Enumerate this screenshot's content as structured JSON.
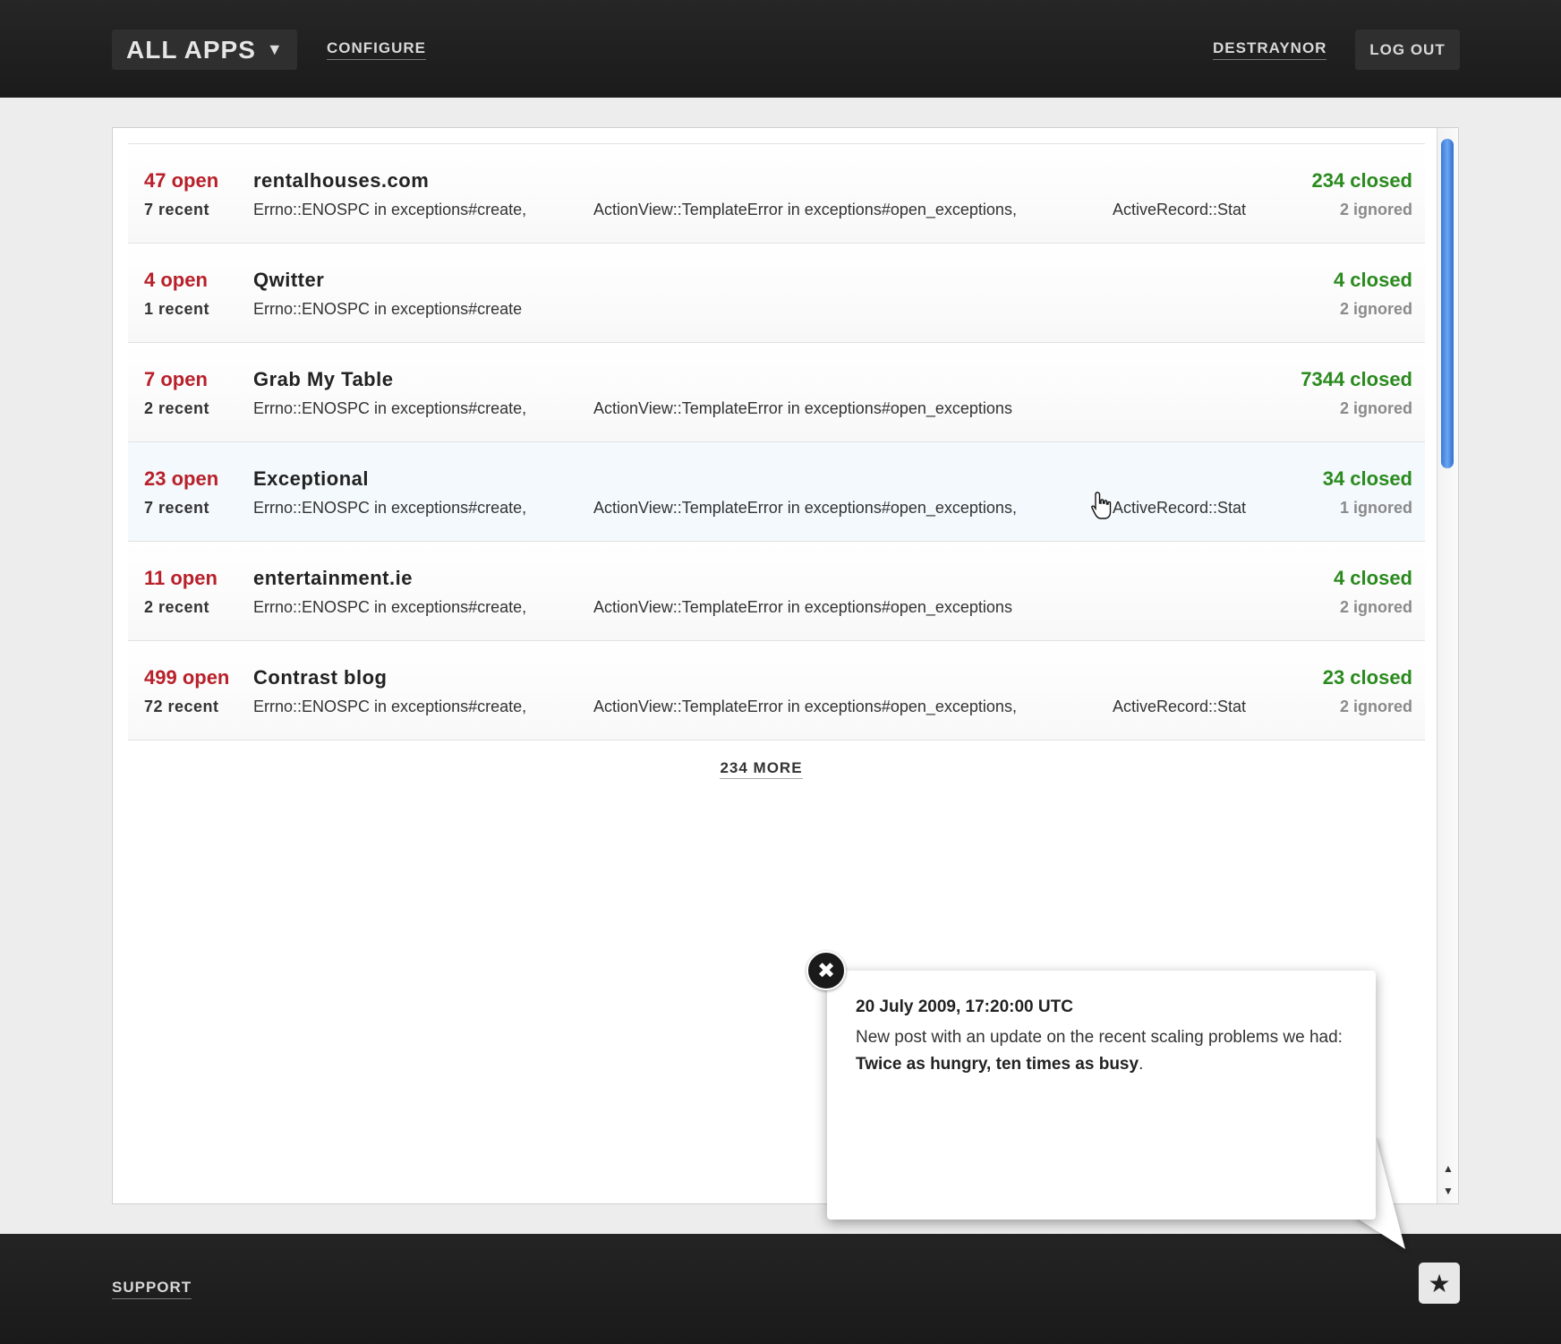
{
  "header": {
    "apps_label": "ALL APPS",
    "configure_label": "CONFIGURE",
    "user_label": "DESTRAYNOR",
    "logout_label": "LOG OUT"
  },
  "apps": [
    {
      "open": "47 open",
      "recent": "7 recent",
      "name": "rentalhouses.com",
      "errors": [
        "Errno::ENOSPC in exceptions#create,",
        "ActionView::TemplateError in exceptions#open_exceptions,",
        "ActiveRecord::Stat"
      ],
      "closed": "234 closed",
      "ignored": "2 ignored"
    },
    {
      "open": "4 open",
      "recent": "1 recent",
      "name": "Qwitter",
      "errors": [
        "Errno::ENOSPC in exceptions#create",
        "",
        ""
      ],
      "closed": "4 closed",
      "ignored": "2 ignored"
    },
    {
      "open": "7 open",
      "recent": "2 recent",
      "name": "Grab My Table",
      "errors": [
        "Errno::ENOSPC in exceptions#create,",
        "ActionView::TemplateError in exceptions#open_exceptions",
        ""
      ],
      "closed": "7344 closed",
      "ignored": "2 ignored"
    },
    {
      "open": "23 open",
      "recent": "7 recent",
      "name": "Exceptional",
      "errors": [
        "Errno::ENOSPC in exceptions#create,",
        "ActionView::TemplateError in exceptions#open_exceptions,",
        "ActiveRecord::Stat"
      ],
      "closed": "34 closed",
      "ignored": "1 ignored"
    },
    {
      "open": "11 open",
      "recent": "2 recent",
      "name": "entertainment.ie",
      "errors": [
        "Errno::ENOSPC in exceptions#create,",
        "ActionView::TemplateError in exceptions#open_exceptions",
        ""
      ],
      "closed": "4 closed",
      "ignored": "2 ignored"
    },
    {
      "open": "499 open",
      "recent": "72 recent",
      "name": "Contrast blog",
      "errors": [
        "Errno::ENOSPC in exceptions#create,",
        "ActionView::TemplateError in exceptions#open_exceptions,",
        "ActiveRecord::Stat"
      ],
      "closed": "23 closed",
      "ignored": "2 ignored"
    }
  ],
  "more_label": "234 MORE",
  "footer": {
    "support_label": "SUPPORT"
  },
  "popup": {
    "date": "20 July 2009, 17:20:00 UTC",
    "text_before": "New post with an update on the recent scaling problems we had: ",
    "link_text": "Twice as hungry, ten times as busy",
    "text_after": "."
  },
  "icons": {
    "apps_caret": "caret-down-icon",
    "close": "close-icon",
    "star": "star-icon",
    "cursor": "hand-cursor-icon"
  },
  "colors": {
    "open": "#b8202a",
    "closed": "#2a8a1e",
    "ignored": "#8a8a8a",
    "bar": "#1f1f1f"
  }
}
